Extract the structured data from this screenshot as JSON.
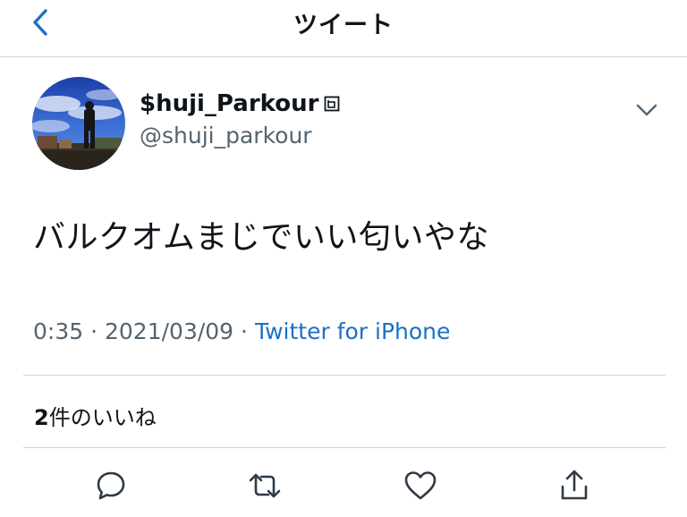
{
  "header": {
    "title": "ツイート",
    "back_icon": "chevron-left-icon"
  },
  "tweet": {
    "display_name": "$huji_Parkour",
    "handle": "@shuji_parkour",
    "text": "バルクオムまじでいい匂いやな",
    "time": "0:35",
    "date": "2021/03/09",
    "separator": "·",
    "source": "Twitter for iPhone",
    "likes_count": "2",
    "likes_label": "件のいいね",
    "menu_icon": "chevron-down-icon"
  },
  "actions": [
    {
      "name": "reply",
      "icon": "comment-icon"
    },
    {
      "name": "retweet",
      "icon": "retweet-icon"
    },
    {
      "name": "like",
      "icon": "heart-icon"
    },
    {
      "name": "share",
      "icon": "share-icon"
    }
  ],
  "colors": {
    "accent": "#1d6fc7",
    "text": "#0f1419",
    "secondary": "#536471",
    "divider": "#cfd4d9"
  }
}
